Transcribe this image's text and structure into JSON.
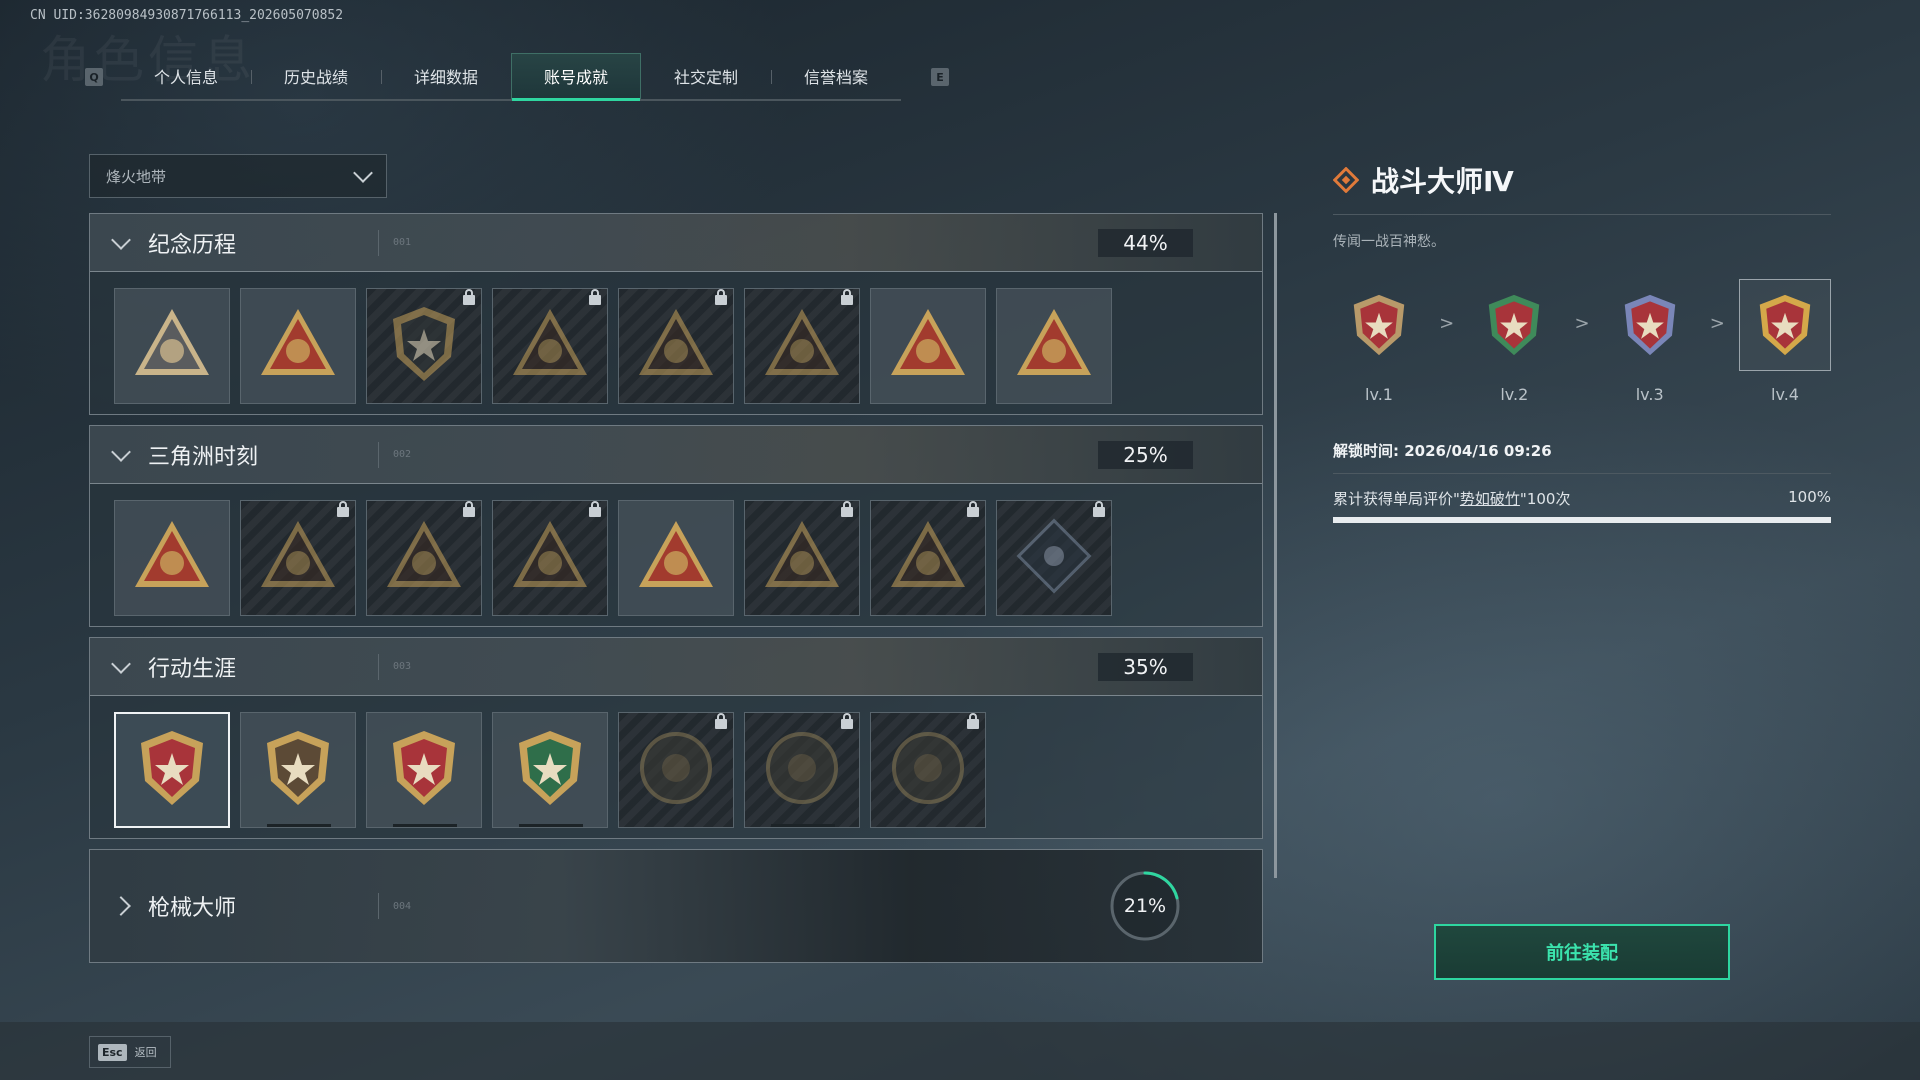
{
  "uid": "CN UID:3628098493087176611З_202605070852",
  "ghost_title": "角色信息",
  "tabs": {
    "left_key": "Q",
    "right_key": "E",
    "items": [
      {
        "label": "个人信息"
      },
      {
        "label": "历史战绩"
      },
      {
        "label": "详细数据"
      },
      {
        "label": "账号成就",
        "active": true
      },
      {
        "label": "社交定制"
      },
      {
        "label": "信誉档案"
      }
    ]
  },
  "dropdown": {
    "value": "烽火地带"
  },
  "sections": [
    {
      "title": "纪念历程",
      "num": "001",
      "percent": "44%",
      "expanded": true,
      "badges": [
        {
          "icon": "triangle-emblem-icon",
          "locked": false
        },
        {
          "icon": "helicopter-emblem-icon",
          "locked": false
        },
        {
          "icon": "shield-emblem-icon",
          "locked": true
        },
        {
          "icon": "gunner-emblem-icon",
          "locked": true
        },
        {
          "icon": "hooded-figure-emblem-icon",
          "locked": true
        },
        {
          "icon": "crossed-swords-emblem-icon",
          "locked": true
        },
        {
          "icon": "golden-wing-emblem-icon",
          "locked": false
        },
        {
          "icon": "number-one-emblem-icon",
          "locked": false
        }
      ]
    },
    {
      "title": "三角洲时刻",
      "num": "002",
      "percent": "25%",
      "expanded": true,
      "badges": [
        {
          "icon": "usb-drive-emblem-icon",
          "locked": false
        },
        {
          "icon": "robot-emblem-icon",
          "locked": true
        },
        {
          "icon": "kneeling-soldier-emblem-icon",
          "locked": true
        },
        {
          "icon": "gear-emblem-icon",
          "locked": true
        },
        {
          "icon": "squad-emblem-icon",
          "locked": false
        },
        {
          "icon": "wolf-emblem-icon",
          "locked": true
        },
        {
          "icon": "eagle-emblem-icon",
          "locked": true
        },
        {
          "icon": "rose-diamond-emblem-icon",
          "locked": true
        }
      ]
    },
    {
      "title": "行动生涯",
      "num": "003",
      "percent": "35%",
      "expanded": true,
      "badges": [
        {
          "icon": "star-medal-icon",
          "locked": false,
          "selected": true
        },
        {
          "icon": "bronze-shield-medal-icon",
          "locked": false,
          "progress": true
        },
        {
          "icon": "blue-star-medal-icon",
          "locked": false,
          "progress": true
        },
        {
          "icon": "green-shield-medal-icon",
          "locked": false,
          "progress": true
        },
        {
          "icon": "round-badge-icon",
          "locked": true
        },
        {
          "icon": "round-skull-badge-icon",
          "locked": true,
          "progress": true
        },
        {
          "icon": "round-eye-badge-icon",
          "locked": true
        }
      ]
    },
    {
      "title": "枪械大师",
      "num": "004",
      "percent": "21%",
      "expanded": false,
      "progress": 0.21
    }
  ],
  "detail": {
    "title": "战斗大师Ⅳ",
    "description": "传闻一战百神愁。",
    "levels": [
      {
        "label": "lv.1",
        "color": "#b89a6a"
      },
      {
        "label": "lv.2",
        "color": "#3f8a5a"
      },
      {
        "label": "lv.3",
        "color": "#7a86b8"
      },
      {
        "label": "lv.4",
        "color": "#d4a84a",
        "current": true
      }
    ],
    "level_arrow": ">",
    "unlock_time": "解锁时间: 2026/04/16 09:26",
    "requirement_prefix": "累计获得单局评价\"",
    "requirement_keyword": "势如破竹",
    "requirement_suffix": "\"100次",
    "requirement_percent": "100%",
    "requirement_progress": 1.0
  },
  "equip_button": {
    "label": "前往装配"
  },
  "footer": {
    "esc_key": "Esc",
    "back_label": "返回"
  },
  "colors": {
    "accent": "#2fd6a0",
    "detail_icon": "#e07a3a"
  }
}
